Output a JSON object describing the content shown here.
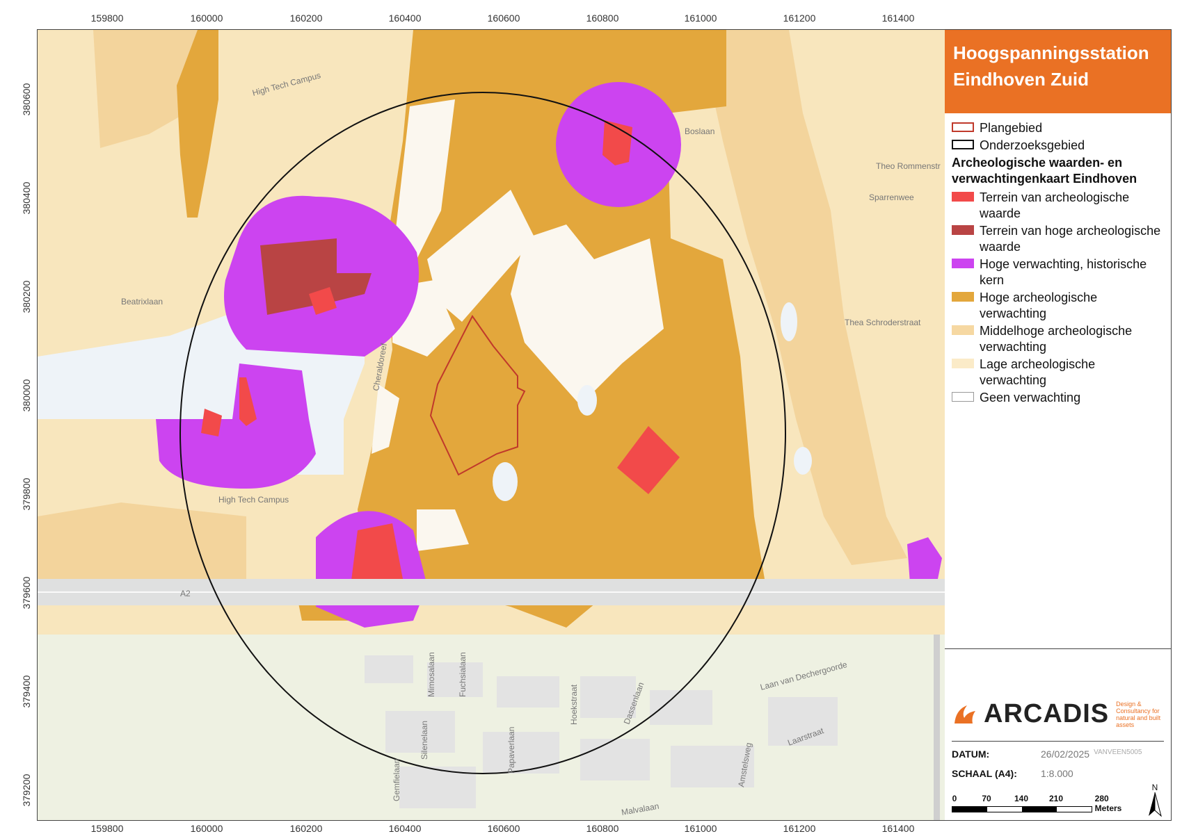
{
  "map": {
    "x_ticks": [
      "159800",
      "160000",
      "160200",
      "160400",
      "160600",
      "160800",
      "161000",
      "161200",
      "161400"
    ],
    "y_ticks": [
      "380600",
      "380400",
      "380200",
      "380000",
      "379800",
      "379600",
      "379400",
      "379200"
    ],
    "road_label": "A2",
    "street_labels": [
      "High Tech Campus",
      "High Tech Campus",
      "Beatrixlaan",
      "Cheraldoreef",
      "Papaverlaan",
      "Mimosalaan",
      "Fuchsialaan",
      "Gemfielaan",
      "Silenelaan",
      "Hoekstraat",
      "Dassenlaan",
      "Laan van Dechergoorde",
      "Laarstraat",
      "Malvalaan",
      "Amstelsweg",
      "Theo Rommenstr",
      "Sparrenwee",
      "Boslaan",
      "Thea Schroderstraat"
    ]
  },
  "panel": {
    "title_line1": "Hoogspanningsstation",
    "title_line2": "Eindhoven Zuid",
    "legend_items_top": [
      {
        "label": "Plangebied",
        "fill": "#ffffff",
        "border": "#c0392b"
      },
      {
        "label": "Onderzoeksgebied",
        "fill": "#ffffff",
        "border": "#111111"
      }
    ],
    "legend_heading": "Archeologische waarden- en verwachtingenkaart Eindhoven",
    "legend_items": [
      {
        "label": "Terrein van archeologische waarde",
        "fill": "#f24a4a",
        "border": "#f24a4a"
      },
      {
        "label": "Terrein van hoge archeologische waarde",
        "fill": "#b94444",
        "border": "#b94444"
      },
      {
        "label": "Hoge verwachting, historische kern",
        "fill": "#cc44f0",
        "border": "#cc44f0"
      },
      {
        "label": "Hoge archeologische verwachting",
        "fill": "#e3a73c",
        "border": "#e3a73c"
      },
      {
        "label": "Middelhoge archeologische verwachting",
        "fill": "#f6d8a2",
        "border": "#f6d8a2"
      },
      {
        "label": "Lage archeologische verwachting",
        "fill": "#fbebc8",
        "border": "#fbebc8"
      },
      {
        "label": "Geen verwachting",
        "fill": "#ffffff",
        "border": "#999999"
      }
    ],
    "logo_text": "ARCADIS",
    "logo_tagline": "Design & Consultancy for natural and built assets",
    "date_label": "DATUM:",
    "date_value": "26/02/2025",
    "author": "VANVEEN5005",
    "scale_label": "SCHAAL (A4):",
    "scale_value": "1:8.000",
    "scalebar_labels": [
      "0",
      "70",
      "140",
      "210",
      "280 Meters"
    ],
    "north": "N"
  },
  "colors": {
    "title_bg": "#ea7124",
    "hoge_waarde": "#b94444",
    "waarde": "#f24a4a",
    "historische_kern": "#cc44f0",
    "hoge": "#e3a73c",
    "middelhoge": "#f6d8a2",
    "lage": "#fbebc8"
  }
}
